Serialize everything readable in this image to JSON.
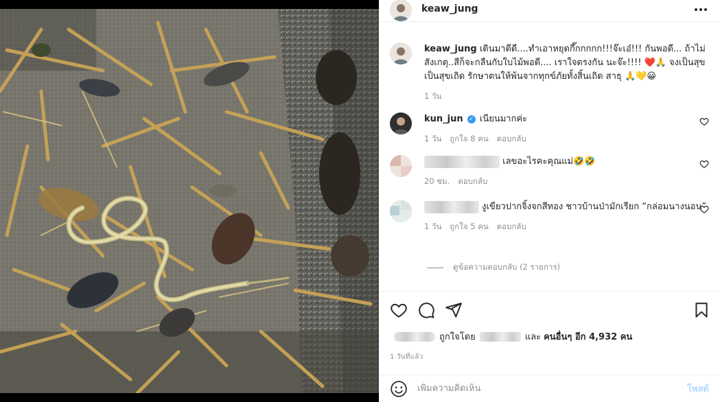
{
  "post": {
    "author": "keaw_jung",
    "more_label": "More options",
    "caption_user": "keaw_jung",
    "caption_text": "เดินมาดีดี....ทำเอาหยุดกึ๊กกกกก!!!จ๊ะเอ๋!!! กันพอดี... ถ้าไม่สังเกตุ..สีก็จะกลืนกับใบไม้พอดี.... เราใจตรงกัน นะจ๊ะ!!!! ",
    "caption_emoji_1": "❤️🙏",
    "caption_text_2": " จงเป็นสุขเป็นสุขเถิด รักษาตนให้พ้นจากทุกข์ภัยทั้งสิ้นเถิด สาธุ ",
    "caption_emoji_2": "🙏💛😀",
    "caption_time": "1 วัน"
  },
  "comments": [
    {
      "user": "kun_jun",
      "verified": "✓",
      "text": "เนียนมากค่ะ",
      "time": "1 วัน",
      "likes": "ถูกใจ 8 คน",
      "reply": "ตอบกลับ"
    },
    {
      "user": "",
      "text": "เลขอะไรคะคุณแม่",
      "emoji": "🤣🤣",
      "time": "20 ชม.",
      "reply": "ตอบกลับ"
    },
    {
      "user": "",
      "text": "งูเขียวปากจิ้งจกสีทอง ชาวบ้านป่ามักเรียก “กล่อมนางนอน”",
      "time": "1 วัน",
      "likes": "ถูกใจ 5 คน",
      "reply": "ตอบกลับ"
    }
  ],
  "view_replies": "ดูข้อความตอบกลับ (2 รายการ)",
  "likes_summary": {
    "prefix": "ถูกใจโดย",
    "suffix": "และ",
    "others": "คนอื่นๆ อีก 4,932 คน"
  },
  "post_time": "1 วันที่แล้ว",
  "add_comment": {
    "placeholder": "เพิ่มความคิดเห็น",
    "post_label": "โพสต์"
  },
  "colors": {
    "accent": "#3897f0",
    "post_disabled": "#b3dbff",
    "muted": "#8e8e8e"
  },
  "icons": [
    "heart-icon",
    "comment-icon",
    "share-icon",
    "bookmark-icon",
    "smile-icon",
    "more-icon"
  ]
}
